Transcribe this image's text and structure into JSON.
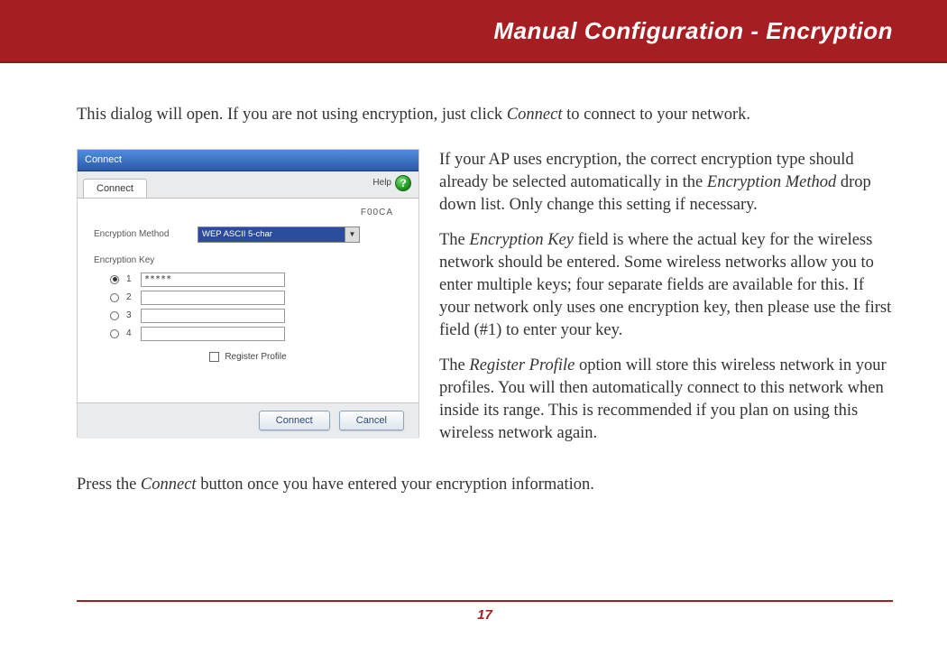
{
  "header": {
    "title": "Manual Configuration - Encryption"
  },
  "intro_full": "This dialog will open.  If you are not using encryption, just click Connect to connect to your network.",
  "intro_a": "This dialog will open.  If you are not using encryption, just click ",
  "intro_em": "Connect",
  "intro_b": " to connect to your network.",
  "screenshot": {
    "window_title": "Connect",
    "tab_label": "Connect",
    "help_label": "Help",
    "help_glyph": "?",
    "ssid": "F00CA",
    "enc_method_label": "Encryption Method",
    "enc_method_value": "WEP ASCII 5-char",
    "enc_key_label": "Encryption Key",
    "keys": [
      {
        "num": "1",
        "checked": true,
        "value": "*****"
      },
      {
        "num": "2",
        "checked": false,
        "value": ""
      },
      {
        "num": "3",
        "checked": false,
        "value": ""
      },
      {
        "num": "4",
        "checked": false,
        "value": ""
      }
    ],
    "register_label": "Register Profile",
    "connect_btn": "Connect",
    "cancel_btn": "Cancel"
  },
  "para1": {
    "a": "If your AP uses encryption, the correct encryption type should already be selected automatically in the ",
    "em": "Encryption Method",
    "b": " drop down list.  Only change this setting if necessary."
  },
  "para2": {
    "a": "The ",
    "em": "Encryption Key",
    "b": " field is where the actual key for the wireless network should be entered.  Some wireless networks allow you to enter multiple keys; four separate fields are available for this.  If your network only uses one encryption key, then please use the first field (#1) to enter your key."
  },
  "para3": {
    "a": "The ",
    "em": "Register Profile",
    "b": " option will store this wireless network in your profiles.  You will then automatically connect to this network when inside its range.  This is recommended if you plan on using this wireless network again."
  },
  "conclude": {
    "a": "Press the ",
    "em": "Connect",
    "b": " button once you have entered your encryption information."
  },
  "page_number": "17"
}
